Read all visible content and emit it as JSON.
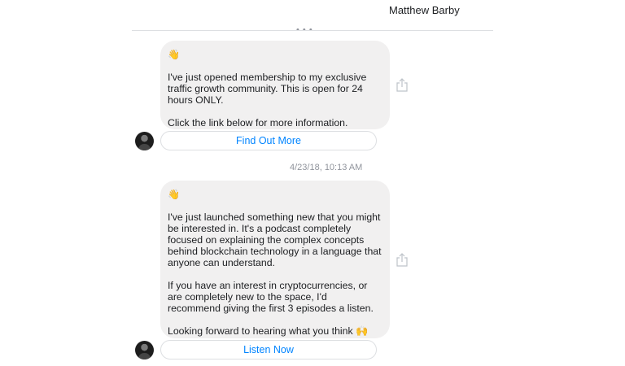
{
  "header": {
    "contact_name": "Matthew Barby"
  },
  "messages": [
    {
      "emoji": "👋",
      "paragraphs": [
        "I've just opened membership to my exclusive traffic growth community. This is open for 24 hours ONLY.",
        "Click the link below for more information."
      ],
      "button_label": "Find Out More"
    },
    {
      "timestamp": "4/23/18, 10:13 AM",
      "emoji": "👋",
      "paragraphs": [
        "I've just launched something new that you might be interested in. It's a podcast completely focused on explaining the complex concepts behind blockchain technology in a language that anyone can understand.",
        "If you have an interest in cryptocurrencies, or are completely new to the space, I'd recommend giving the first 3 episodes a listen.",
        "Looking forward to hearing what you think 🙌"
      ],
      "button_label": "Listen Now"
    }
  ],
  "icons": {
    "share": "share-icon",
    "avatar": "avatar"
  },
  "colors": {
    "bubble_bg": "#f1f0f0",
    "link_blue": "#0084ff",
    "timestamp_gray": "#90949c",
    "divider": "#dddfe2"
  }
}
